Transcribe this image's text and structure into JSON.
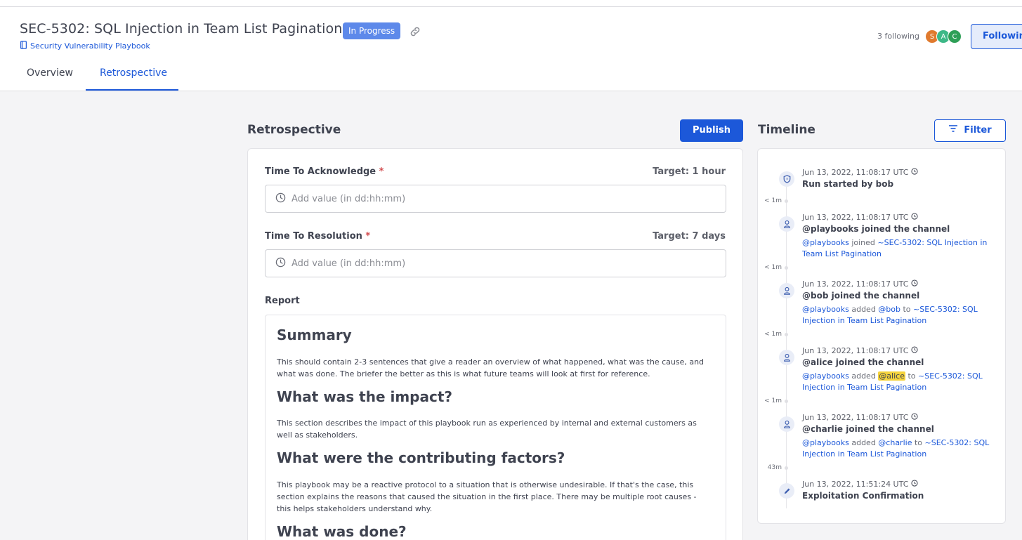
{
  "header": {
    "title": "SEC-5302: SQL Injection in Team List Pagination",
    "status": "In Progress",
    "playbook_link": "Security Vulnerability Playbook",
    "following_count": "3 following",
    "avatars": [
      "S",
      "A",
      "C"
    ],
    "following_button": "Following",
    "tabs": [
      "Overview",
      "Retrospective"
    ]
  },
  "colors": {
    "accent": "#1c58d9",
    "status_badge": "#5d89ea",
    "avatar_s": "#e07a2e",
    "avatar_a": "#3db887",
    "avatar_c": "#2f9f57",
    "mention_highlight": "#f5d33c"
  },
  "retrospective": {
    "section_title": "Retrospective",
    "publish_label": "Publish",
    "fields": [
      {
        "label": "Time To Acknowledge",
        "required_mark": "*",
        "target": "Target: 1 hour",
        "placeholder": "Add value (in dd:hh:mm)"
      },
      {
        "label": "Time To Resolution",
        "required_mark": "*",
        "target": "Target: 7 days",
        "placeholder": "Add value (in dd:hh:mm)"
      }
    ],
    "report_label": "Report",
    "report": [
      {
        "heading": "Summary",
        "text": "This should contain 2-3 sentences that give a reader an overview of what happened, what was the cause, and what was done. The briefer the better as this is what future teams will look at first for reference."
      },
      {
        "heading": "What was the impact?",
        "text": "This section describes the impact of this playbook run as experienced by internal and external customers as well as stakeholders."
      },
      {
        "heading": "What were the contributing factors?",
        "text": "This playbook may be a reactive protocol to a situation that is otherwise undesirable. If that's the case, this section explains the reasons that caused the situation in the first place. There may be multiple root causes - this helps stakeholders understand why."
      },
      {
        "heading": "What was done?",
        "text": ""
      }
    ]
  },
  "timeline": {
    "section_title": "Timeline",
    "filter_label": "Filter",
    "events": [
      {
        "icon": "shield-icon",
        "time": "Jun 13, 2022, 11:08:17 UTC",
        "title": "Run started by bob"
      },
      {
        "icon": "user-icon",
        "time": "Jun 13, 2022, 11:08:17 UTC",
        "title": "@playbooks joined the channel",
        "actor": "@playbooks",
        "verb": " joined ",
        "target": "~SEC-5302: SQL Injection in Team List Pagination"
      },
      {
        "icon": "user-icon",
        "time": "Jun 13, 2022, 11:08:17 UTC",
        "title": "@bob joined the channel",
        "actor": "@playbooks",
        "verb": " added ",
        "mention": "@bob",
        "to": " to ",
        "target": "~SEC-5302: SQL Injection in Team List Pagination"
      },
      {
        "icon": "user-icon",
        "time": "Jun 13, 2022, 11:08:17 UTC",
        "title": "@alice joined the channel",
        "actor": "@playbooks",
        "verb": " added ",
        "mention": "@alice",
        "to": " to ",
        "target": "~SEC-5302: SQL Injection in Team List Pagination"
      },
      {
        "icon": "user-icon",
        "time": "Jun 13, 2022, 11:08:17 UTC",
        "title": "@charlie joined the channel",
        "actor": "@playbooks",
        "verb": " added ",
        "mention": "@charlie",
        "to": " to ",
        "target": "~SEC-5302: SQL Injection in Team List Pagination"
      },
      {
        "icon": "pencil-icon",
        "time": "Jun 13, 2022, 11:51:24 UTC",
        "title": "Exploitation Confirmation"
      }
    ],
    "gaps": [
      "< 1m",
      "< 1m",
      "< 1m",
      "< 1m",
      "43m"
    ]
  }
}
